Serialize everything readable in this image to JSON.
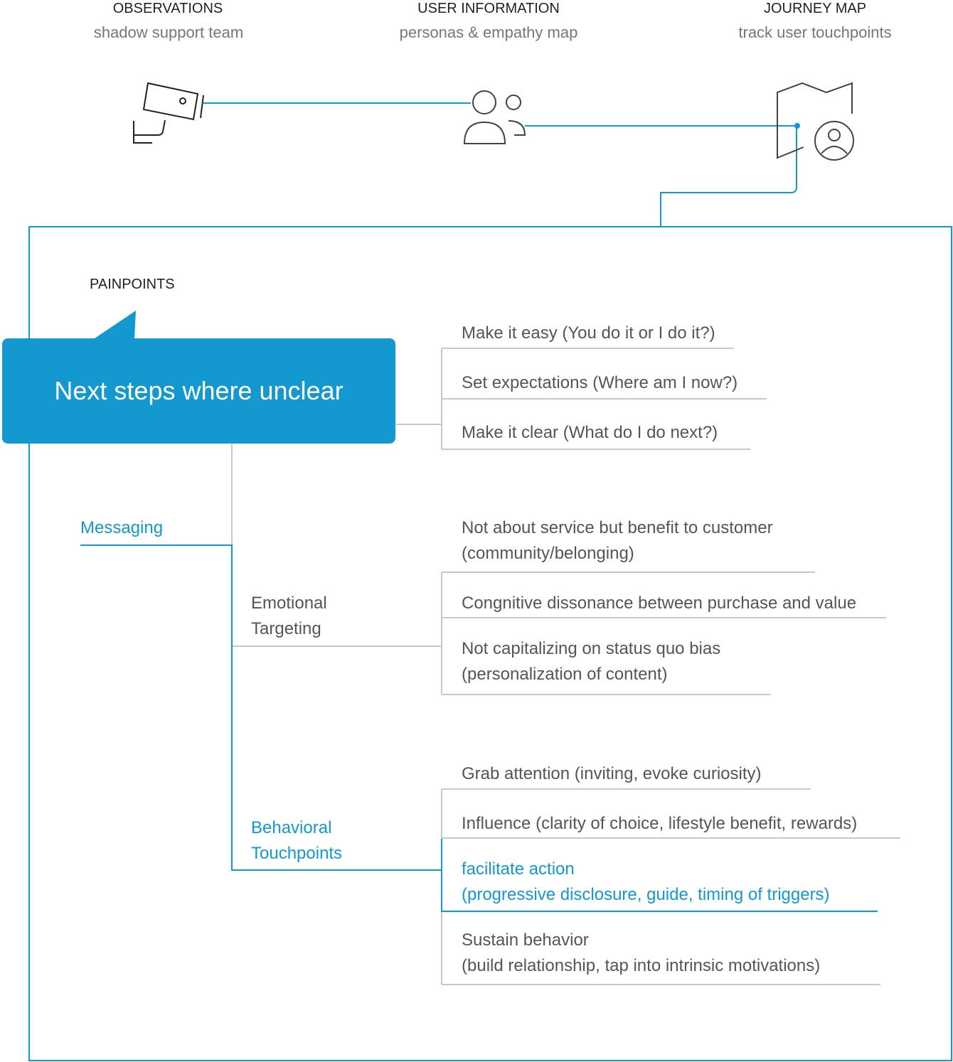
{
  "stages": [
    {
      "title": "OBSERVATIONS",
      "subtitle": "shadow support team",
      "icon": "security-camera-icon"
    },
    {
      "title": "USER INFORMATION",
      "subtitle": "personas & empathy map",
      "icon": "users-icon"
    },
    {
      "title": "JOURNEY MAP",
      "subtitle": "track user touchpoints",
      "icon": "map-user-icon"
    }
  ],
  "section_label": "PAINPOINTS",
  "callout": "Next steps where unclear",
  "callout_items": [
    "Make it easy (You do it or I do it?)",
    "Set expectations (Where am I now?)",
    "Make it clear (What do I do next?)"
  ],
  "branch_messaging": "Messaging",
  "branch_emotional": "Emotional\nTargeting",
  "emotional_items": [
    "Not about service but benefit to customer\n(community/belonging)",
    "Congnitive dissonance between purchase and value",
    "Not capitalizing on status quo bias\n(personalization of content)"
  ],
  "branch_behavioral": "Behavioral\nTouchpoints",
  "behavioral_items": [
    "Grab attention (inviting, evoke curiosity)",
    "Influence (clarity of choice, lifestyle benefit, rewards)",
    "facilitate action\n(progressive disclosure, guide, timing of triggers)",
    "Sustain behavior\n(build relationship, tap into intrinsic motivations)"
  ],
  "colors": {
    "accent": "#1399d0",
    "line": "#c8c8c8",
    "text": "#555555"
  }
}
